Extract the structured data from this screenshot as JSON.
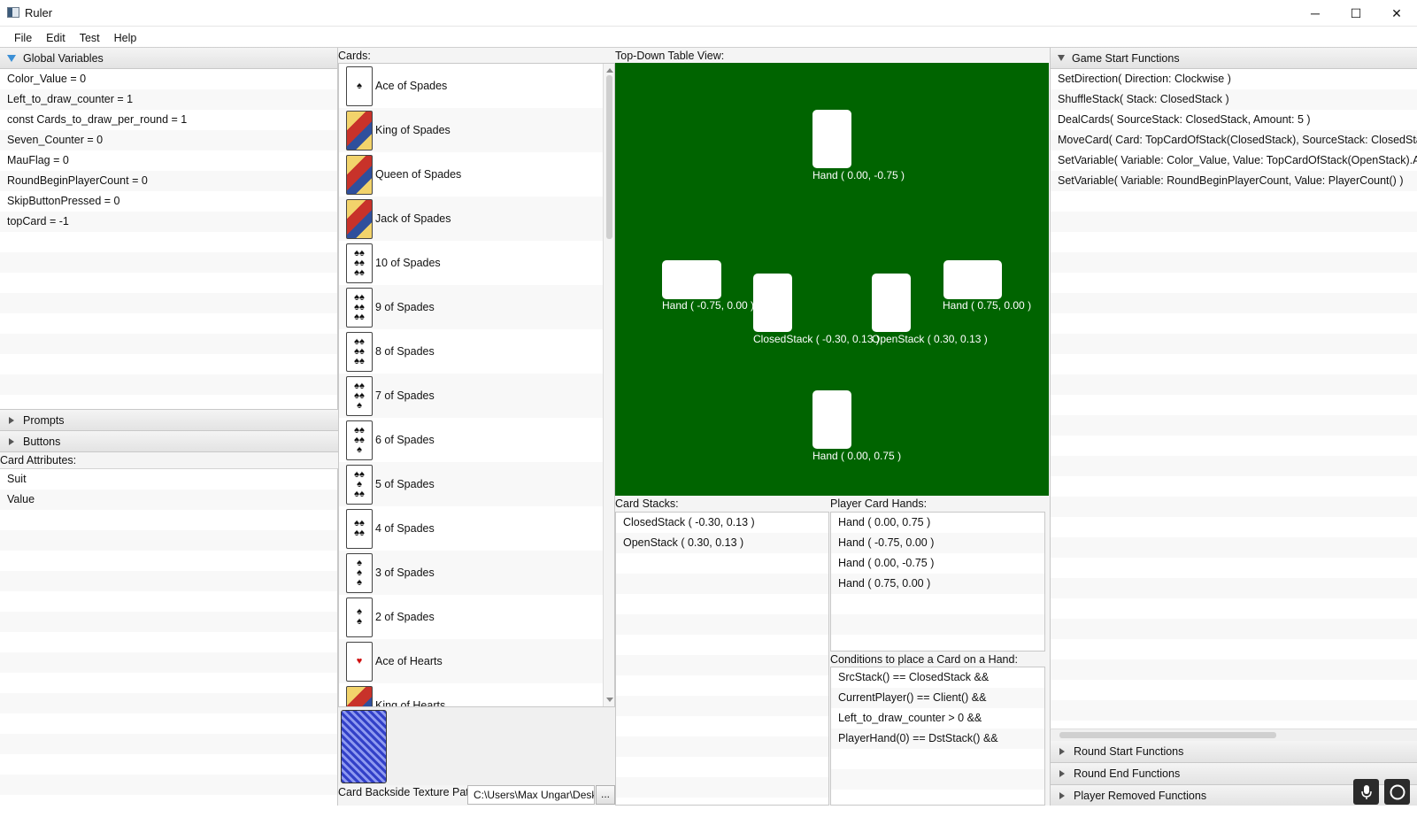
{
  "window": {
    "title": "Ruler",
    "minimize": "─",
    "maximize": "☐",
    "close": "✕"
  },
  "menu": [
    "File",
    "Edit",
    "Test",
    "Help"
  ],
  "left": {
    "global_vars_title": "Global Variables",
    "global_vars": [
      "Color_Value = 0",
      "Left_to_draw_counter = 1",
      "const Cards_to_draw_per_round = 1",
      "Seven_Counter = 0",
      "MauFlag = 0",
      "RoundBeginPlayerCount = 0",
      "SkipButtonPressed = 0",
      "topCard = -1"
    ],
    "prompts_title": "Prompts",
    "buttons_title": "Buttons",
    "card_attributes_label": "Card Attributes:",
    "card_attributes": [
      "Suit",
      "Value"
    ]
  },
  "cards": {
    "label": "Cards:",
    "items": [
      {
        "name": "Ace of Spades",
        "glyph": "♠",
        "face": false,
        "red": false
      },
      {
        "name": "King of Spades",
        "glyph": "",
        "face": true,
        "red": false
      },
      {
        "name": "Queen of Spades",
        "glyph": "",
        "face": true,
        "red": false
      },
      {
        "name": "Jack of Spades",
        "glyph": "",
        "face": true,
        "red": false
      },
      {
        "name": "10 of Spades",
        "glyph": "♠♠\n♠♠\n♠♠",
        "face": false,
        "red": false
      },
      {
        "name": "9 of Spades",
        "glyph": "♠♠\n♠♠\n♠♠",
        "face": false,
        "red": false
      },
      {
        "name": "8 of Spades",
        "glyph": "♠♠\n♠♠\n♠♠",
        "face": false,
        "red": false
      },
      {
        "name": "7 of Spades",
        "glyph": "♠♠\n♠♠\n♠",
        "face": false,
        "red": false
      },
      {
        "name": "6 of Spades",
        "glyph": "♠♠\n♠♠\n♠",
        "face": false,
        "red": false
      },
      {
        "name": "5 of Spades",
        "glyph": "♠♠\n♠\n♠♠",
        "face": false,
        "red": false
      },
      {
        "name": "4 of Spades",
        "glyph": "♠♠\n♠♠",
        "face": false,
        "red": false
      },
      {
        "name": "3 of Spades",
        "glyph": "♠\n♠\n♠",
        "face": false,
        "red": false
      },
      {
        "name": "2 of Spades",
        "glyph": "♠\n♠",
        "face": false,
        "red": false
      },
      {
        "name": "Ace of Hearts",
        "glyph": "♥",
        "face": false,
        "red": true
      },
      {
        "name": "King of Hearts",
        "glyph": "",
        "face": true,
        "red": true
      }
    ],
    "backside_label": "Card Backside Texture Path:",
    "backside_path": "C:\\Users\\Max Ungar\\Desk",
    "browse_label": "..."
  },
  "table_view": {
    "label": "Top-Down Table View:",
    "hands": {
      "top": "Hand ( 0.00, -0.75 )",
      "left": "Hand ( -0.75, 0.00 )",
      "right": "Hand ( 0.75, 0.00 )",
      "bottom": "Hand ( 0.00, 0.75 )"
    },
    "stacks": {
      "closed": "ClosedStack ( -0.30, 0.13 )",
      "open": "OpenStack ( 0.30, 0.13 )"
    }
  },
  "card_stacks": {
    "label": "Card Stacks:",
    "items": [
      "ClosedStack ( -0.30, 0.13 )",
      "OpenStack ( 0.30, 0.13 )"
    ]
  },
  "player_hands": {
    "label": "Player Card Hands:",
    "items": [
      "Hand ( 0.00, 0.75 )",
      "Hand ( -0.75, 0.00 )",
      "Hand ( 0.00, -0.75 )",
      "Hand ( 0.75, 0.00 )"
    ]
  },
  "conditions": {
    "label": "Conditions to place a Card on a Hand:",
    "items": [
      "SrcStack() == ClosedStack &&",
      "CurrentPlayer() == Client() &&",
      "Left_to_draw_counter > 0 &&",
      "PlayerHand(0) == DstStack() &&"
    ]
  },
  "functions": {
    "game_start_title": "Game Start Functions",
    "game_start": [
      "SetDirection( Direction: Clockwise )",
      "ShuffleStack( Stack: ClosedStack )",
      "DealCards( SourceStack: ClosedStack, Amount: 5 )",
      "MoveCard( Card: TopCardOfStack(ClosedStack), SourceStack: ClosedStac",
      "SetVariable( Variable: Color_Value, Value: TopCardOfStack(OpenStack).A",
      "SetVariable( Variable: RoundBeginPlayerCount, Value: PlayerCount() )"
    ],
    "round_start_title": "Round Start Functions",
    "round_end_title": "Round End Functions",
    "player_removed_title": "Player Removed Functions"
  },
  "icons": {
    "mic": "microphone-icon",
    "cortana": "circle-icon"
  }
}
